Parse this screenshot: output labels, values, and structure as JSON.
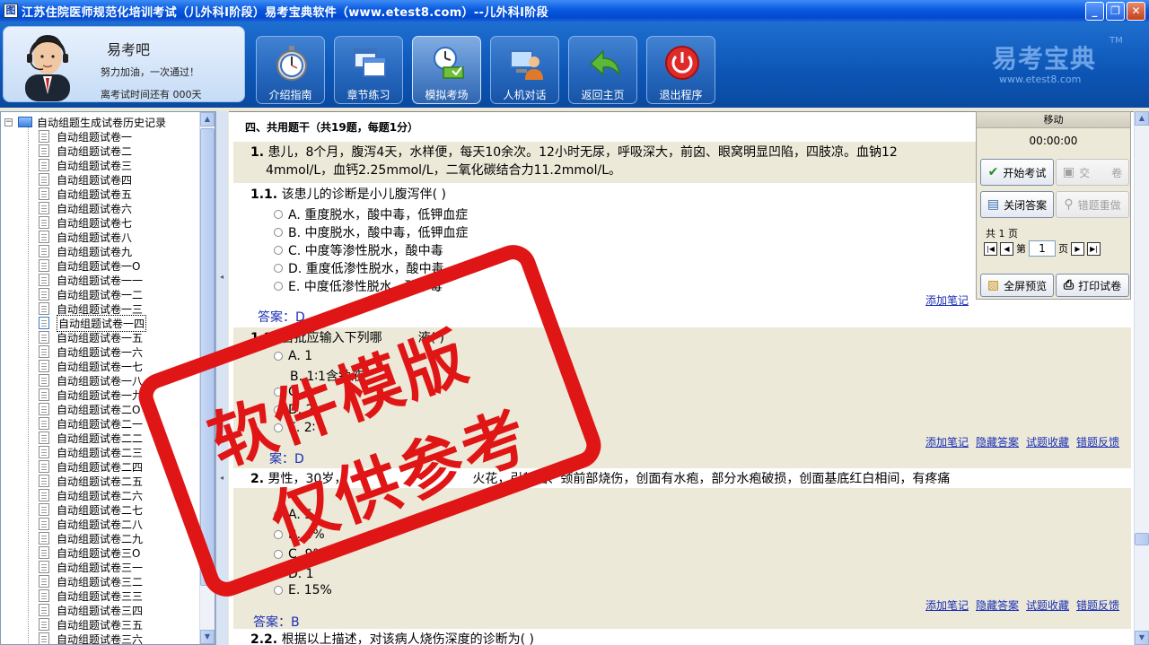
{
  "window": {
    "title": "江苏住院医师规范化培训考试（儿外科Ⅰ阶段）易考宝典软件（www.etest8.com）--儿外科Ⅰ阶段",
    "icon_text": "图",
    "controls": [
      "_",
      "❐",
      "✕"
    ]
  },
  "profile": {
    "name": "易考吧",
    "slogan": "努力加油，一次通过！",
    "days_text": "离考试时间还有 000天"
  },
  "nav": [
    {
      "label": "介绍指南",
      "icon": "stopwatch-icon"
    },
    {
      "label": "章节练习",
      "icon": "windows-icon"
    },
    {
      "label": "模拟考场",
      "icon": "clock-computer-icon",
      "active": true
    },
    {
      "label": "人机对话",
      "icon": "user-computer-icon"
    },
    {
      "label": "返回主页",
      "icon": "back-arrow-icon"
    },
    {
      "label": "退出程序",
      "icon": "power-icon"
    }
  ],
  "brand": {
    "name": "易考宝典",
    "tm": "TM",
    "url": "www.etest8.com"
  },
  "tree": {
    "root": "自动组题生成试卷历史记录",
    "expander": "−",
    "items": [
      "自动组题试卷一",
      "自动组题试卷二",
      "自动组题试卷三",
      "自动组题试卷四",
      "自动组题试卷五",
      "自动组题试卷六",
      "自动组题试卷七",
      "自动组题试卷八",
      "自动组题试卷九",
      "自动组题试卷一O",
      "自动组题试卷一一",
      "自动组题试卷一二",
      "自动组题试卷一三",
      "自动组题试卷一四",
      "自动组题试卷一五",
      "自动组题试卷一六",
      "自动组题试卷一七",
      "自动组题试卷一八",
      "自动组题试卷一九",
      "自动组题试卷二O",
      "自动组题试卷二一",
      "自动组题试卷二二",
      "自动组题试卷二三",
      "自动组题试卷二四",
      "自动组题试卷二五",
      "自动组题试卷二六",
      "自动组题试卷二七",
      "自动组题试卷二八",
      "自动组题试卷二九",
      "自动组题试卷三O",
      "自动组题试卷三一",
      "自动组题试卷三二",
      "自动组题试卷三三",
      "自动组题试卷三四",
      "自动组题试卷三五",
      "自动组题试卷三六"
    ],
    "selected_index": 13
  },
  "content": {
    "section_title": "四、共用题干（共19题，每题1分）",
    "q1": {
      "num": "1.",
      "stem_line1": "患儿，8个月，腹泻4天，水样便，每天10余次。12小时无尿，呼吸深大，前囟、眼窝明显凹陷，四肢凉。血钠12",
      "stem_line2": "4mmol/L，血钙2.25mmol/L，二氧化碳结合力11.2mmol/L。"
    },
    "q1_1": {
      "num": "1.1.",
      "text": "该患儿的诊断是小儿腹泻伴(  )",
      "options": [
        "A. 重度脱水，酸中毒，低钾血症",
        "B. 中度脱水，酸中毒，低钾血症",
        "C. 中度等渗性脱水，酸中毒",
        "D. 重度低渗性脱水，酸中毒",
        "E. 中度低渗性脱水，酸中毒"
      ],
      "answer": "答案：D"
    },
    "q1_2": {
      "num": "1.2.",
      "text": "首批应输入下列哪",
      "text_end": "液(  )",
      "options": [
        "A. 1",
        "B. 1∶1含钠液",
        "C. 2",
        "D. 2",
        "E. 2∶"
      ],
      "answer": "案：D"
    },
    "q2": {
      "num": "2.",
      "stem_a": "男性，30岁，",
      "stem_b": "火花，引起面、颈前部烧伤，创面有水疱，部分水疱破损，创面基底红白相间，有疼痛",
      "options": [
        "A. 5",
        "B. 4%",
        "C. 9%",
        "D. 1",
        "E. 15%"
      ],
      "answer": "答案：B"
    },
    "q2_2": {
      "num": "2.2.",
      "text": "根据以上描述，对该病人烧伤深度的诊断为(  )"
    },
    "links": [
      "添加笔记",
      "隐藏答案",
      "试题收藏",
      "错题反馈"
    ]
  },
  "panel": {
    "move": "移动",
    "timer": "00:00:00",
    "start": "开始考试",
    "submit": "交　　卷",
    "close_answer": "关闭答案",
    "redo": "错题重做",
    "pages_total": "共 1 页",
    "page_prefix": "第",
    "page_value": "1",
    "page_suffix": "页",
    "preview": "全屏预览",
    "print": "打印试卷"
  },
  "watermark": {
    "line1": "软件模版",
    "line2": "仅供参考"
  }
}
